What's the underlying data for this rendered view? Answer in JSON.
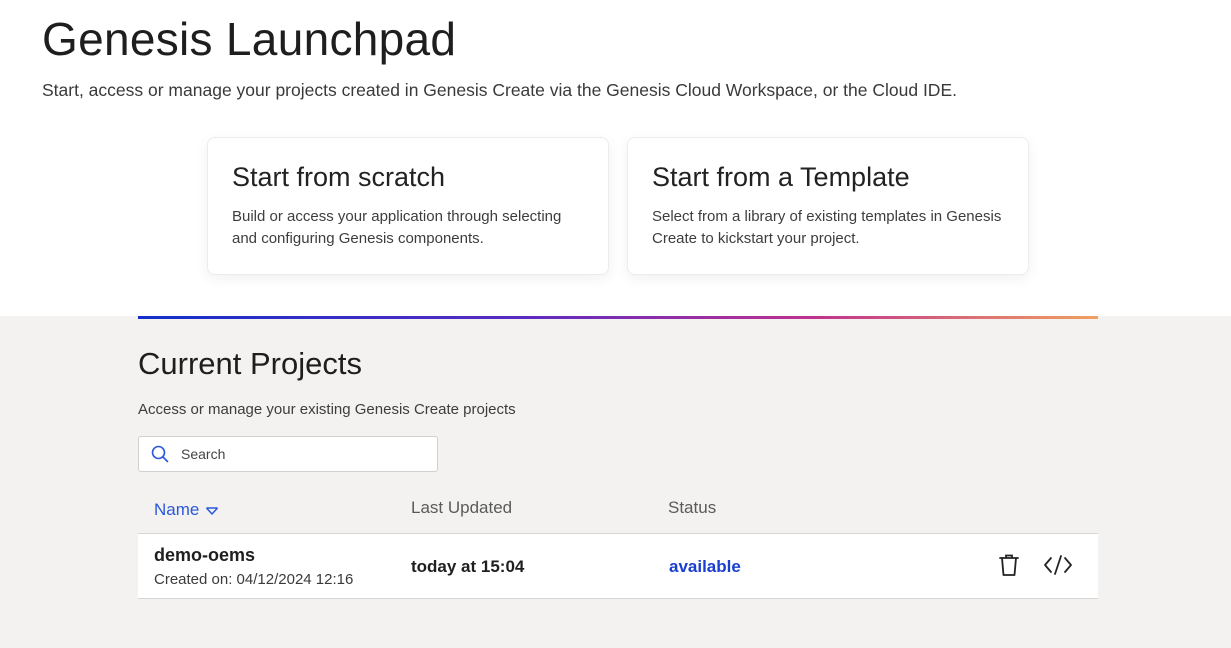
{
  "header": {
    "title": "Genesis Launchpad",
    "subtitle": "Start, access or manage your projects created in Genesis Create via the Genesis Cloud Workspace, or the Cloud IDE."
  },
  "cards": [
    {
      "title": "Start from scratch",
      "description": "Build or access your application through selecting and configuring Genesis components."
    },
    {
      "title": "Start from a Template",
      "description": "Select from a library of existing templates in Genesis Create to kickstart your project."
    }
  ],
  "projects_section": {
    "title": "Current Projects",
    "subtitle": "Access or manage your existing Genesis Create projects",
    "search": {
      "placeholder": "Search",
      "value": ""
    },
    "columns": {
      "name": "Name",
      "last_updated": "Last Updated",
      "status": "Status"
    },
    "rows": [
      {
        "name": "demo-oems",
        "created": "Created on: 04/12/2024 12:16",
        "last_updated": "today at 15:04",
        "status": "available"
      }
    ]
  },
  "icons": {
    "search": "search-icon",
    "sort": "chevron-down-icon",
    "delete": "trash-icon",
    "code": "code-icon"
  },
  "colors": {
    "accent_blue": "#2b58d8",
    "status_available": "#1a3fd0",
    "gradient": [
      "#1230c9",
      "#5a2bc1",
      "#c0318f",
      "#f0a060"
    ],
    "section_bg": "#f3f2f1"
  }
}
